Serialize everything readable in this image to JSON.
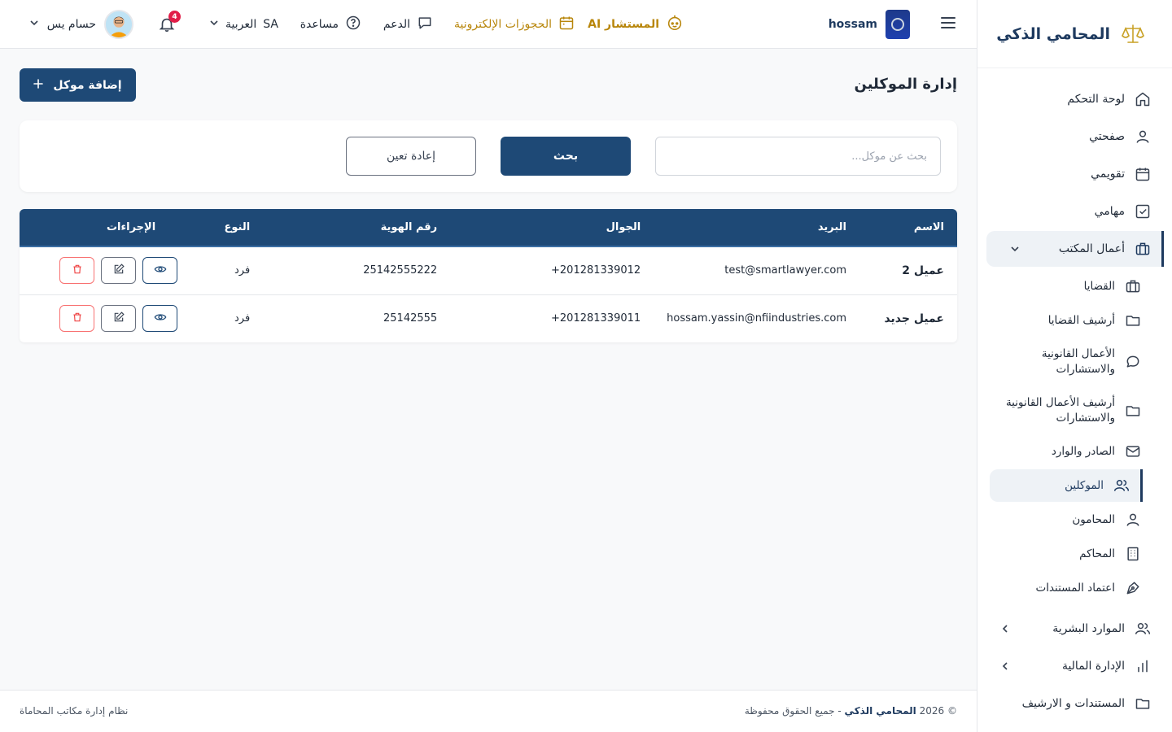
{
  "brand": {
    "name": "المحامي الذكي"
  },
  "topbar": {
    "username": "hossam",
    "ai_label": "المستشار AI",
    "bookings_label": "الحجوزات الإلكترونية",
    "support_label": "الدعم",
    "help_label": "مساعدة",
    "lang_code": "SA",
    "lang_label": "العربية",
    "notifications_count": "4",
    "profile_name": "حسام يس"
  },
  "sidebar": {
    "items": [
      {
        "label": "لوحة التحكم",
        "icon": "home-icon"
      },
      {
        "label": "صفحتي",
        "icon": "user-icon"
      },
      {
        "label": "تقويمي",
        "icon": "calendar-icon"
      },
      {
        "label": "مهامي",
        "icon": "check-square-icon"
      },
      {
        "label": "أعمال المكتب",
        "icon": "briefcase-icon",
        "expanded": true
      },
      {
        "label": "القضايا",
        "icon": "briefcase-icon"
      },
      {
        "label": "أرشيف القضايا",
        "icon": "folder-icon"
      },
      {
        "label": "الأعمال القانونية والاستشارات",
        "icon": "chat-icon"
      },
      {
        "label": "أرشيف الأعمال القانونية والاستشارات",
        "icon": "folder-icon"
      },
      {
        "label": "الصادر والوارد",
        "icon": "mail-icon"
      },
      {
        "label": "الموكلين",
        "icon": "users-icon",
        "active": true
      },
      {
        "label": "المحامون",
        "icon": "user-icon"
      },
      {
        "label": "المحاكم",
        "icon": "building-icon"
      },
      {
        "label": "اعتماد المستندات",
        "icon": "pen-nib-icon"
      },
      {
        "label": "الموارد البشرية",
        "icon": "users-icon"
      },
      {
        "label": "الإدارة المالية",
        "icon": "bar-chart-icon"
      },
      {
        "label": "المستندات و الارشيف",
        "icon": "folder-icon"
      }
    ]
  },
  "page": {
    "title": "إدارة الموكلين",
    "add_button": "إضافة موكل",
    "search_placeholder": "بحث عن موكل...",
    "search_button": "بحث",
    "reset_button": "إعادة تعين"
  },
  "table": {
    "headers": [
      "الاسم",
      "البريد",
      "الجوال",
      "رقم الهوية",
      "النوع",
      "الإجراءات"
    ],
    "rows": [
      {
        "name": "عميل 2",
        "email": "test@smartlawyer.com",
        "phone": "201281339012+",
        "id_number": "25142555222",
        "type": "فرد"
      },
      {
        "name": "عميل جديد",
        "email": "hossam.yassin@nfiindustries.com",
        "phone": "201281339011+",
        "id_number": "25142555",
        "type": "فرد"
      }
    ]
  },
  "footer": {
    "copyright_prefix": "© 2026",
    "brand": "المحامي الذكي",
    "rights": "- جميع الحقوق محفوظة",
    "system_name": "نظام إدارة مكاتب المحاماة"
  },
  "colors": {
    "primary": "#1e4976",
    "accent_gold": "#b8860b",
    "danger": "#f87171"
  }
}
